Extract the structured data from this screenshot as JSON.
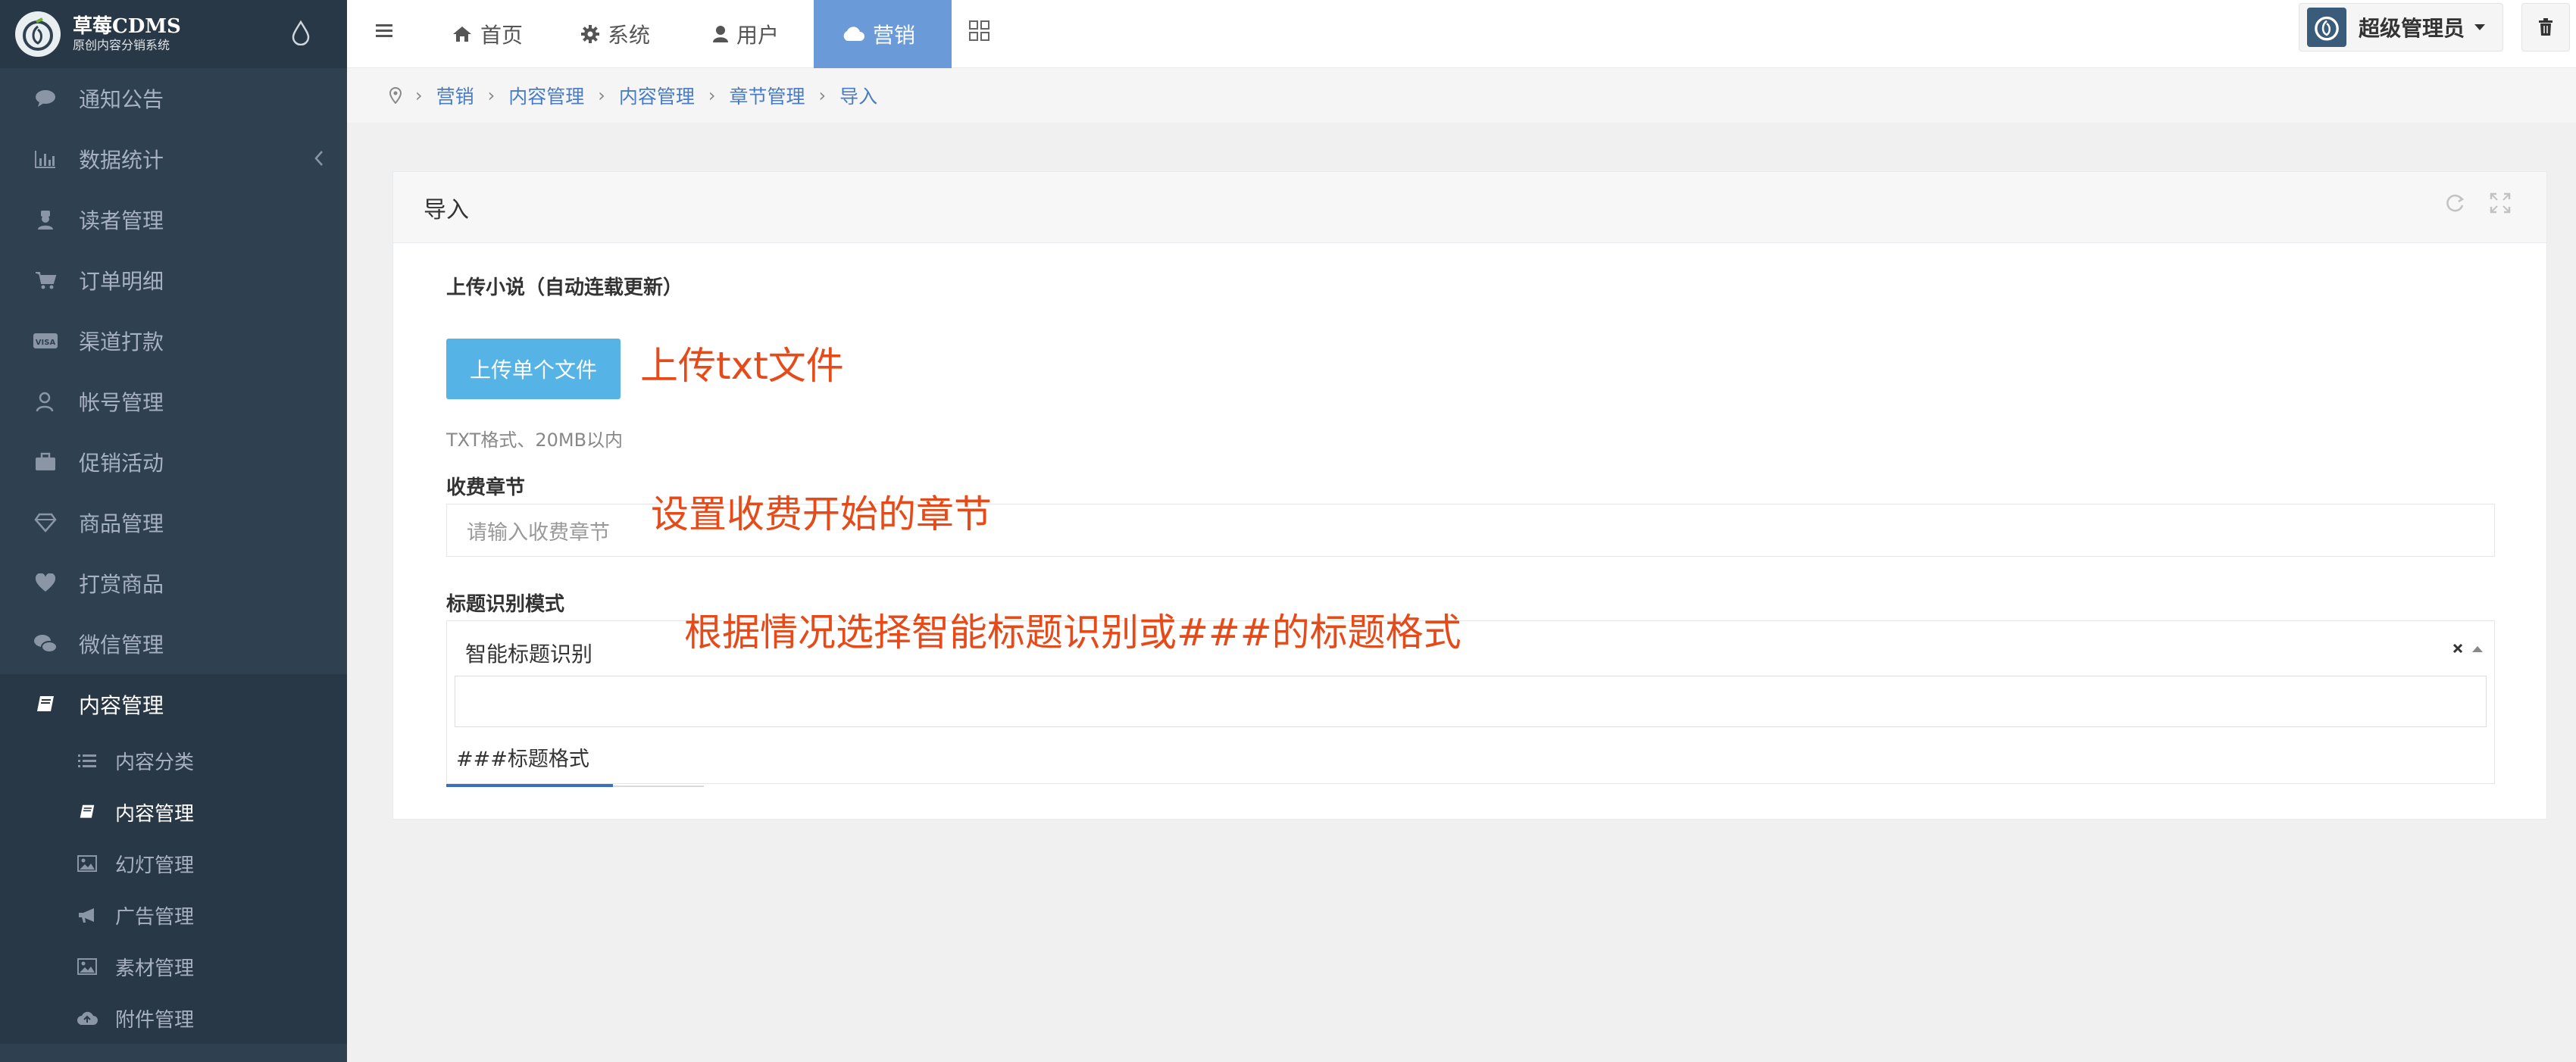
{
  "brand": {
    "title": "草莓CDMS",
    "subtitle": "原创内容分销系统"
  },
  "sidebar": {
    "items": [
      {
        "label": "通知公告",
        "icon": "comment-icon"
      },
      {
        "label": "数据统计",
        "icon": "bar-chart-icon"
      },
      {
        "label": "读者管理",
        "icon": "user-secret-icon"
      },
      {
        "label": "订单明细",
        "icon": "cart-icon"
      },
      {
        "label": "渠道打款",
        "icon": "visa-icon"
      },
      {
        "label": "帐号管理",
        "icon": "user-outline-icon"
      },
      {
        "label": "促销活动",
        "icon": "briefcase-icon"
      },
      {
        "label": "商品管理",
        "icon": "diamond-icon"
      },
      {
        "label": "打赏商品",
        "icon": "heart-icon"
      },
      {
        "label": "微信管理",
        "icon": "wechat-icon"
      },
      {
        "label": "内容管理",
        "icon": "book-icon"
      }
    ],
    "subitems": [
      {
        "label": "内容分类",
        "icon": "list-icon"
      },
      {
        "label": "内容管理",
        "icon": "book-icon"
      },
      {
        "label": "幻灯管理",
        "icon": "image-icon"
      },
      {
        "label": "广告管理",
        "icon": "bullhorn-icon"
      },
      {
        "label": "素材管理",
        "icon": "image-icon"
      },
      {
        "label": "附件管理",
        "icon": "cloud-upload-icon"
      }
    ]
  },
  "topnav": {
    "home": "首页",
    "system": "系统",
    "user": "用户",
    "marketing": "营销",
    "admin": "超级管理员"
  },
  "breadcrumb": [
    "营销",
    "内容管理",
    "内容管理",
    "章节管理",
    "导入"
  ],
  "panel": {
    "title": "导入",
    "upload_label": "上传小说（自动连载更新）",
    "upload_button": "上传单个文件",
    "upload_note": "上传txt文件",
    "upload_help": "TXT格式、20MB以内",
    "fee_label": "收费章节",
    "fee_placeholder": "请输入收费章节",
    "fee_note": "设置收费开始的章节",
    "mode_label": "标题识别模式",
    "mode_selected": "智能标题识别",
    "mode_note": "根据情况选择智能标题识别或###的标题格式",
    "mode_option": "###标题格式"
  },
  "colors": {
    "sidebar_bg": "#2f4050",
    "accent": "#6a9ad7",
    "upload_button": "#55b3e6",
    "annotation": "#e64a19"
  }
}
